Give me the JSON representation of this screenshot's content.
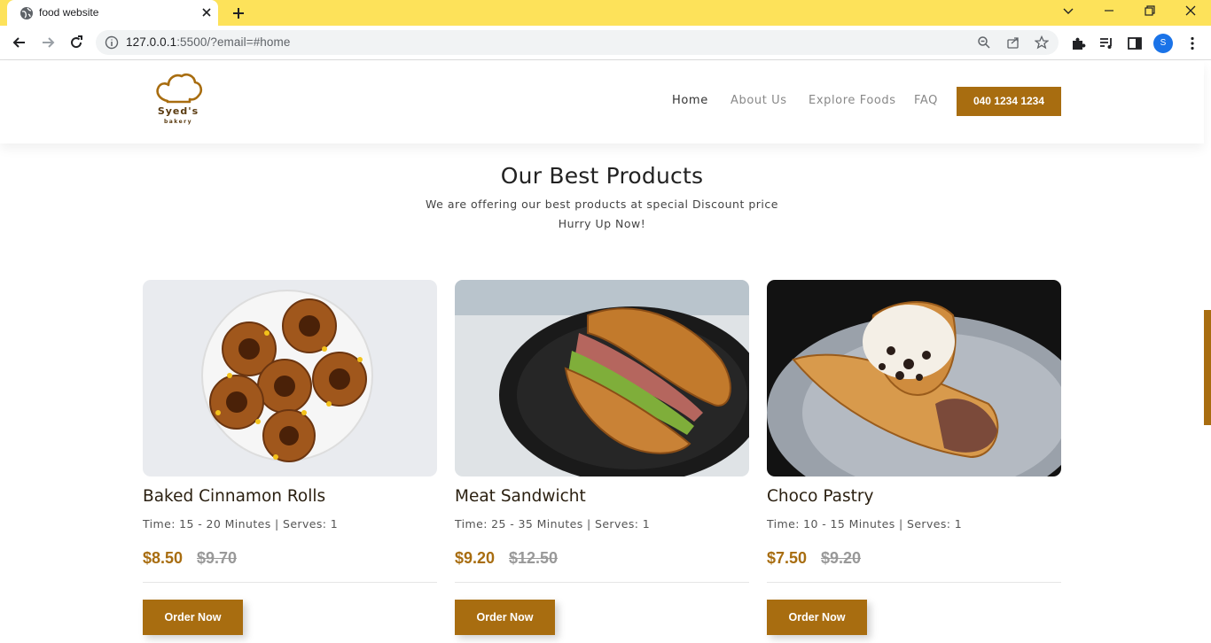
{
  "browser": {
    "tab_title": "food website",
    "url_host": "127.0.0.1",
    "url_rest": ":5500/?email=#home",
    "profile_initial": "S"
  },
  "header": {
    "logo_name": "Syed's",
    "logo_sub": "bakery",
    "nav": [
      "Home",
      "About Us",
      "Explore Foods",
      "FAQ"
    ],
    "phone": "040 1234 1234"
  },
  "section": {
    "title": "Our Best Products",
    "subtitle_line1": "We are offering our best products at special Discount price",
    "subtitle_line2": "Hurry Up Now!"
  },
  "products": [
    {
      "name": "Baked Cinnamon Rolls",
      "meta": "Time: 15 - 20 Minutes | Serves: 1",
      "price": "$8.50",
      "old_price": "$9.70",
      "button": "Order Now"
    },
    {
      "name": "Meat Sandwicht",
      "meta": "Time: 25 - 35 Minutes | Serves: 1",
      "price": "$9.20",
      "old_price": "$12.50",
      "button": "Order Now"
    },
    {
      "name": "Choco Pastry",
      "meta": "Time: 10 - 15 Minutes | Serves: 1",
      "price": "$7.50",
      "old_price": "$9.20",
      "button": "Order Now"
    }
  ],
  "colors": {
    "accent": "#a86d10",
    "tabbar": "#fde25a"
  }
}
